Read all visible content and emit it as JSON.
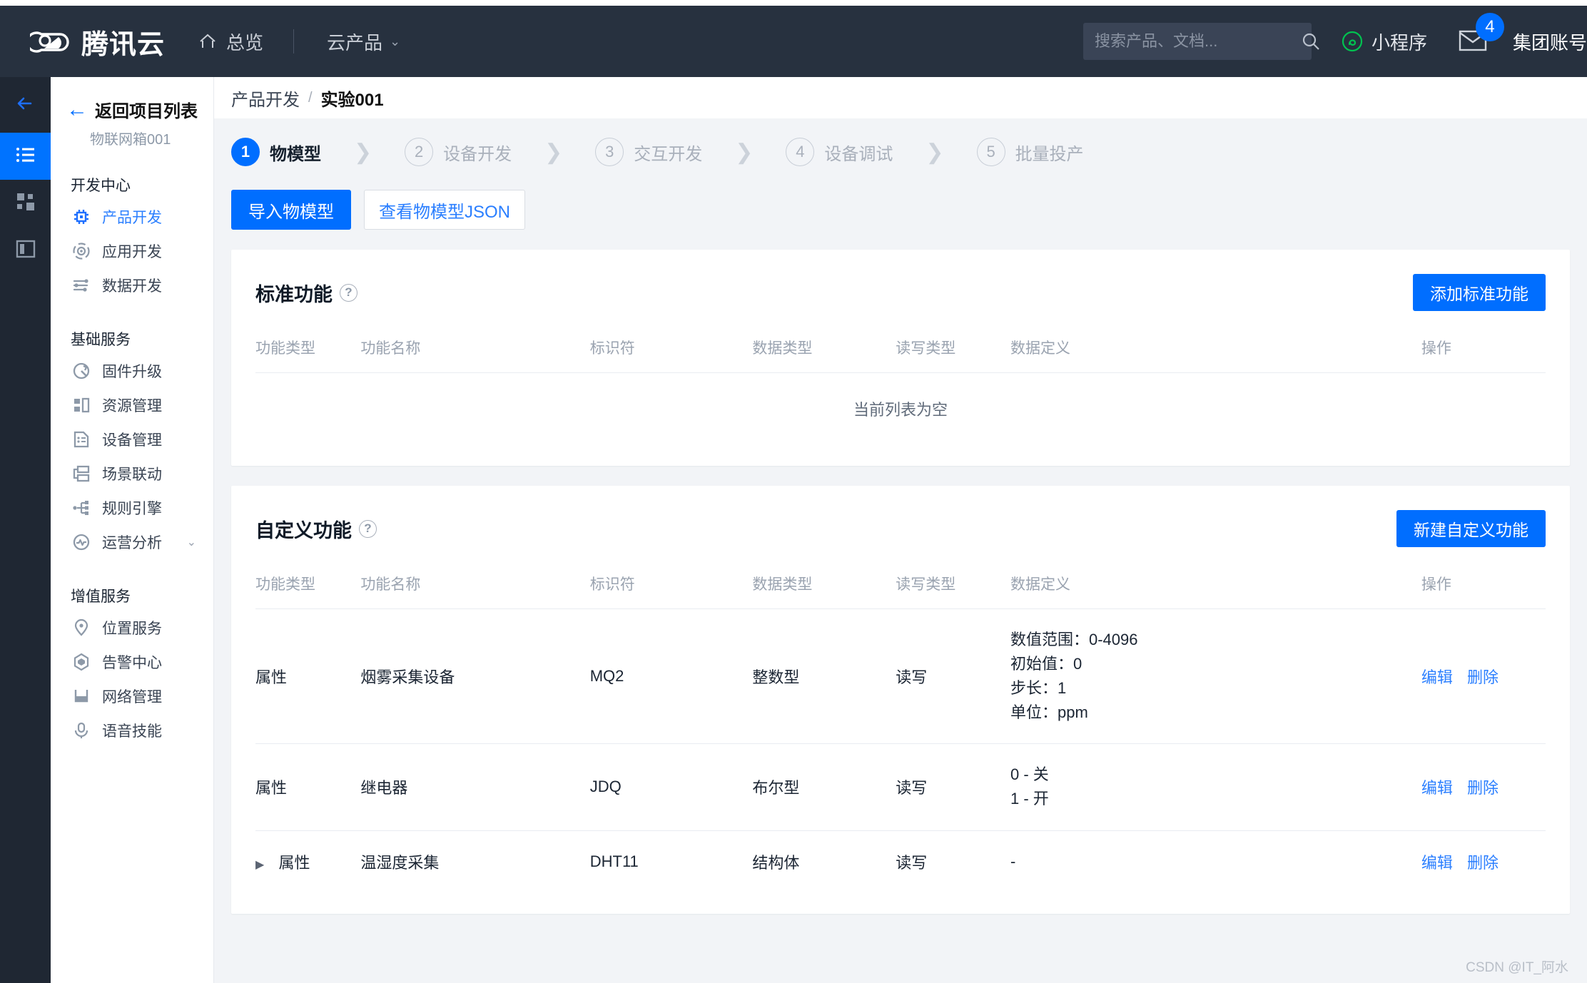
{
  "header": {
    "brand": "腾讯云",
    "nav": [
      {
        "label": "总览",
        "icon": "home-icon"
      },
      {
        "label": "云产品",
        "icon": "chevron-down-icon"
      }
    ],
    "search": {
      "placeholder": "搜索产品、文档...",
      "value": "",
      "icon": "search-icon"
    },
    "miniprogram": {
      "label": "小程序",
      "icon": "miniprogram-icon",
      "color": "#00c250"
    },
    "mail": {
      "icon": "mail-icon",
      "badge": "4",
      "badge_color": "#006eff"
    },
    "account": "集团账号"
  },
  "rail": {
    "items": [
      {
        "name": "collapse-back",
        "icon": "arrow-left-icon",
        "active": false
      },
      {
        "name": "project-list",
        "icon": "list-icon",
        "active": true
      },
      {
        "name": "apps",
        "icon": "grid-icon",
        "active": false
      },
      {
        "name": "docs",
        "icon": "book-icon",
        "active": false
      }
    ]
  },
  "sidebar": {
    "back_label": "返回项目列表",
    "project_name": "物联网箱001",
    "groups": [
      {
        "title": "开发中心",
        "items": [
          {
            "label": "产品开发",
            "icon": "chip-icon",
            "active": true
          },
          {
            "label": "应用开发",
            "icon": "target-icon",
            "active": false
          },
          {
            "label": "数据开发",
            "icon": "sliders-icon",
            "active": false
          }
        ]
      },
      {
        "title": "基础服务",
        "items": [
          {
            "label": "固件升级",
            "icon": "refresh-circle-icon",
            "active": false
          },
          {
            "label": "资源管理",
            "icon": "blocks-icon",
            "active": false
          },
          {
            "label": "设备管理",
            "icon": "device-doc-icon",
            "active": false
          },
          {
            "label": "场景联动",
            "icon": "scene-link-icon",
            "active": false
          },
          {
            "label": "规则引擎",
            "icon": "rule-node-icon",
            "active": false
          },
          {
            "label": "运营分析",
            "icon": "pulse-circle-icon",
            "active": false,
            "expandable": true
          }
        ]
      },
      {
        "title": "增值服务",
        "items": [
          {
            "label": "位置服务",
            "icon": "map-pin-icon",
            "active": false
          },
          {
            "label": "告警中心",
            "icon": "alert-hex-icon",
            "active": false
          },
          {
            "label": "网络管理",
            "icon": "network-icon",
            "active": false
          },
          {
            "label": "语音技能",
            "icon": "mic-icon",
            "active": false
          }
        ]
      }
    ]
  },
  "breadcrumb": {
    "parent": "产品开发",
    "separator": "/",
    "current": "实验001"
  },
  "steps": [
    {
      "num": "1",
      "label": "物模型",
      "active": true
    },
    {
      "num": "2",
      "label": "设备开发",
      "active": false
    },
    {
      "num": "3",
      "label": "交互开发",
      "active": false
    },
    {
      "num": "4",
      "label": "设备调试",
      "active": false
    },
    {
      "num": "5",
      "label": "批量投产",
      "active": false
    }
  ],
  "actions": {
    "import_label": "导入物模型",
    "view_json_label": "查看物模型JSON"
  },
  "table_columns": [
    "功能类型",
    "功能名称",
    "标识符",
    "数据类型",
    "读写类型",
    "数据定义",
    "操作"
  ],
  "standard_card": {
    "title": "标准功能",
    "help_icon": "question-icon",
    "add_button": "添加标准功能",
    "empty_text": "当前列表为空"
  },
  "custom_card": {
    "title": "自定义功能",
    "help_icon": "question-icon",
    "add_button": "新建自定义功能",
    "rows": [
      {
        "expandable": false,
        "type": "属性",
        "name": "烟雾采集设备",
        "identifier": "MQ2",
        "data_type": "整数型",
        "rw_type": "读写",
        "definition": [
          "数值范围：0-4096",
          "初始值：0",
          "步长：1",
          "单位：ppm"
        ],
        "edit": "编辑",
        "delete": "删除"
      },
      {
        "expandable": false,
        "type": "属性",
        "name": "继电器",
        "identifier": "JDQ",
        "data_type": "布尔型",
        "rw_type": "读写",
        "definition": [
          "0 - 关",
          "1 - 开"
        ],
        "edit": "编辑",
        "delete": "删除"
      },
      {
        "expandable": true,
        "type": "属性",
        "name": "温湿度采集",
        "identifier": "DHT11",
        "data_type": "结构体",
        "rw_type": "读写",
        "definition": [
          "-"
        ],
        "edit": "编辑",
        "delete": "删除"
      }
    ]
  },
  "watermark": "CSDN @IT_阿水"
}
